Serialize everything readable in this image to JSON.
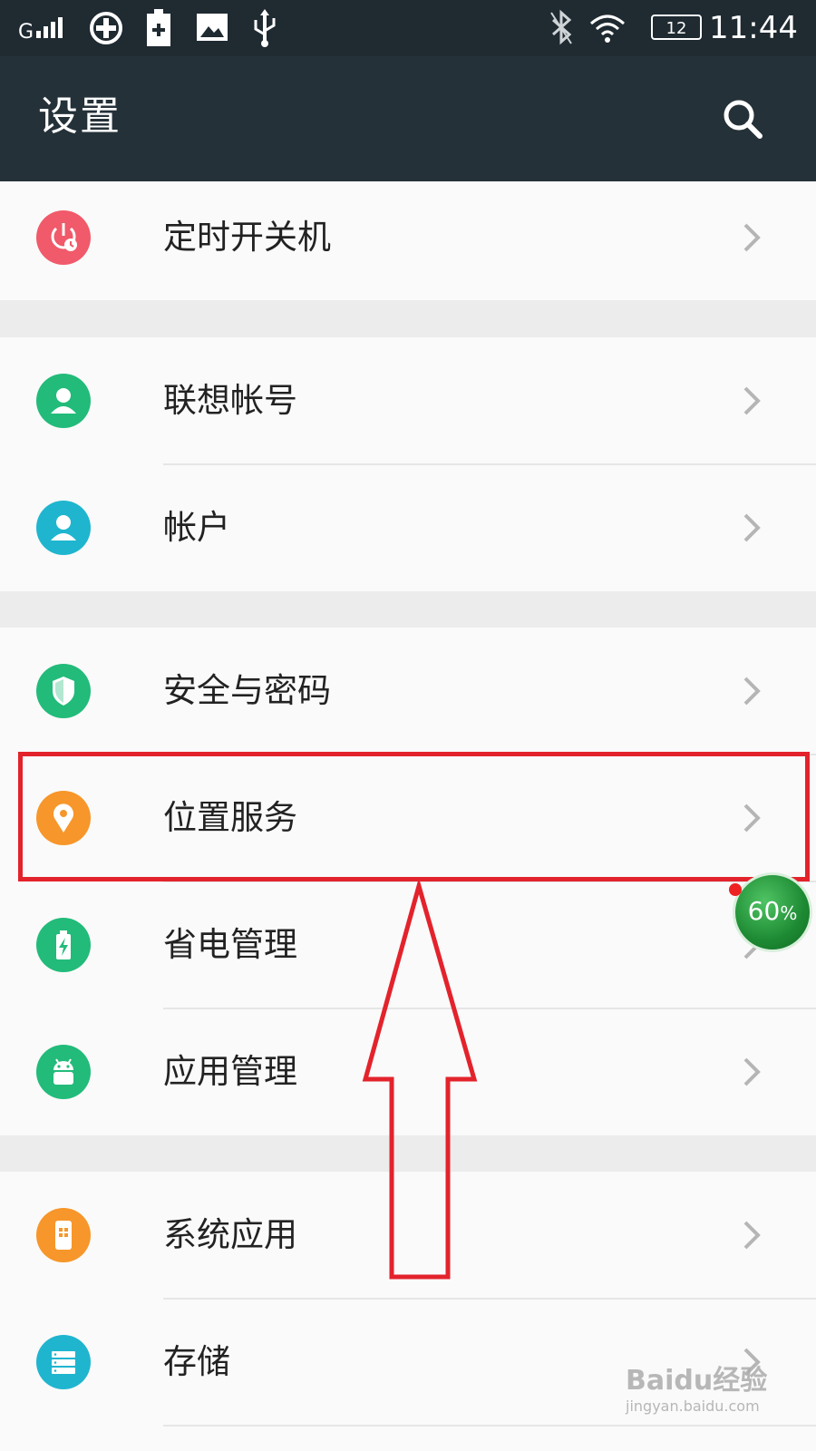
{
  "status_bar": {
    "signal": "G",
    "battery_level": "12",
    "time": "11:44"
  },
  "app_bar": {
    "title": "设置"
  },
  "settings": [
    {
      "label": "定时开关机",
      "icon": "power-schedule-icon",
      "color": "#f05a6a"
    },
    {
      "label": "联想帐号",
      "icon": "user-icon",
      "color": "#22bb7a"
    },
    {
      "label": "帐户",
      "icon": "account-icon",
      "color": "#1fb5cf"
    },
    {
      "label": "安全与密码",
      "icon": "shield-icon",
      "color": "#22bb7a"
    },
    {
      "label": "位置服务",
      "icon": "location-pin-icon",
      "color": "#f7962a"
    },
    {
      "label": "省电管理",
      "icon": "battery-icon",
      "color": "#22bb7a"
    },
    {
      "label": "应用管理",
      "icon": "android-icon",
      "color": "#22bb7a"
    },
    {
      "label": "系统应用",
      "icon": "phone-app-icon",
      "color": "#f7962a"
    },
    {
      "label": "存储",
      "icon": "storage-icon",
      "color": "#1fb5cf"
    }
  ],
  "floating_badge": {
    "value": "60",
    "unit": "%"
  },
  "annotation": {
    "color": "#e3232c"
  },
  "watermark": {
    "main": "Baidu经验",
    "sub": "jingyan.baidu.com"
  }
}
